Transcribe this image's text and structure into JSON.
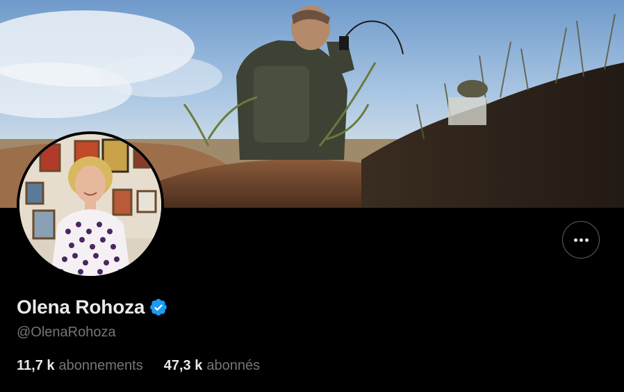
{
  "profile": {
    "display_name": "Olena Rohoza",
    "handle": "@OlenaRohoza",
    "verified": true
  },
  "stats": {
    "following_count": "11,7 k",
    "following_label": "abonnements",
    "followers_count": "47,3 k",
    "followers_label": "abonnés"
  },
  "colors": {
    "background": "#000000",
    "primary_text": "#e7e9ea",
    "secondary_text": "#71767b",
    "verified_blue": "#1d9bf0",
    "button_border": "#536471"
  },
  "icons": {
    "more": "more-horizontal-icon",
    "verified": "verified-badge-icon"
  }
}
